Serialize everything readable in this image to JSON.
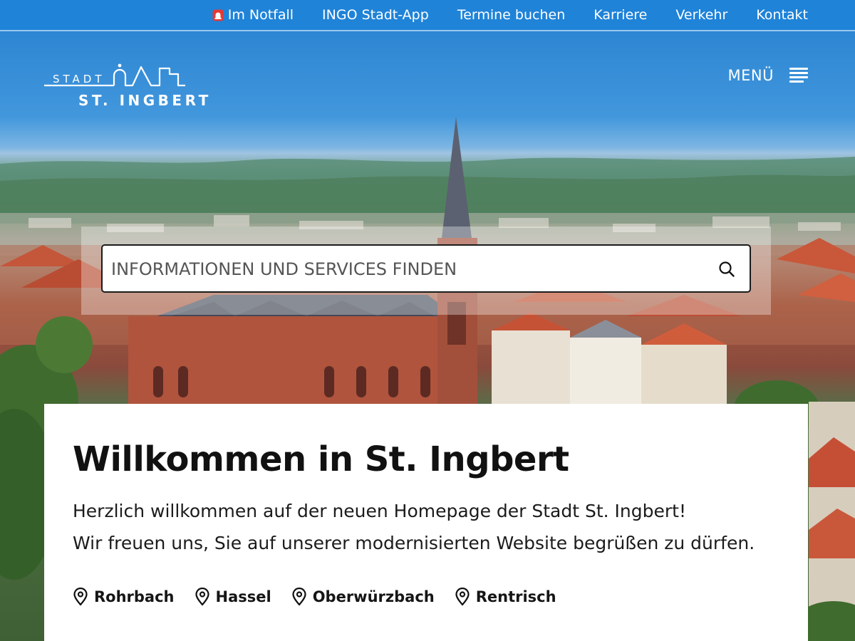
{
  "topnav": {
    "items": [
      {
        "label": "Im Notfall",
        "icon": "alarm-light-icon"
      },
      {
        "label": "INGO Stadt-App"
      },
      {
        "label": "Termine buchen"
      },
      {
        "label": "Karriere"
      },
      {
        "label": "Verkehr"
      },
      {
        "label": "Kontakt"
      }
    ]
  },
  "header": {
    "logo_line1": "STADT",
    "logo_line2": "ST. INGBERT",
    "menu_label": "MENÜ"
  },
  "search": {
    "placeholder": "INFORMATIONEN UND SERVICES FINDEN",
    "value": ""
  },
  "welcome": {
    "title": "Willkommen in St. Ingbert",
    "line1": "Herzlich willkommen auf der neuen Homepage der Stadt St. Ingbert!",
    "line2": "Wir freuen uns, Sie auf unserer modernisierten Website begrüßen zu dürfen.",
    "districts": [
      "Rohrbach",
      "Hassel",
      "Oberwürzbach",
      "Rentrisch"
    ]
  },
  "colors": {
    "topbar_bg": "#1f83d8",
    "alarm_red": "#e53935",
    "text_dark": "#111111"
  }
}
